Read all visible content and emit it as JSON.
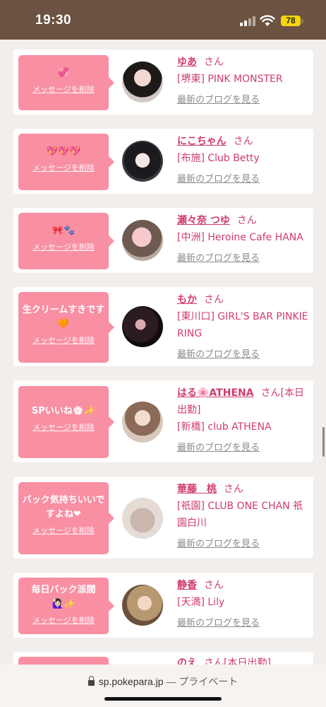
{
  "status": {
    "time": "19:30",
    "battery": "78"
  },
  "cards": [
    {
      "message": "💞",
      "delete": "メッセージを削除",
      "name": "ゆあ",
      "san": "さん",
      "shop": "[堺東] PINK MONSTER",
      "blog": "最新のブログを見る"
    },
    {
      "message": "💖💖💖",
      "delete": "メッセージを削除",
      "name": "にこちゃん",
      "san": "さん",
      "shop": "[布施] Club Betty",
      "blog": "最新のブログを見る"
    },
    {
      "message": "🎀🐾",
      "delete": "メッセージを削除",
      "name": "瀬々奈 つゆ",
      "san": "さん",
      "shop": "[中洲] Heroine Cafe HANA",
      "blog": "最新のブログを見る"
    },
    {
      "message": "生クリームすきです🧡",
      "delete": "メッセージを削除",
      "name": "もか",
      "san": "さん",
      "shop": "[東川口] GIRL'S BAR PINKIE RING",
      "blog": "最新のブログを見る"
    },
    {
      "message": "SPいいね💮✨",
      "delete": "メッセージを削除",
      "name": "はる🌸ATHENA",
      "san": "さん[本日出勤]",
      "shop": "[新橋] club ATHENA",
      "blog": "最新のブログを見る"
    },
    {
      "message": "バック気持ちいいですよね❤",
      "delete": "メッセージを削除",
      "name": "華藤　桃",
      "san": "さん",
      "shop": "[祇園] CLUB ONE CHAN 祇園白川",
      "blog": "最新のブログを見る"
    },
    {
      "message": "毎日バック派閥🙋🏻‍♀️✨",
      "delete": "メッセージを削除",
      "name": "静香",
      "san": "さん",
      "shop": "[天満] Lily",
      "blog": "最新のブログを見る"
    },
    {
      "message": "",
      "delete": "",
      "name": "のえ",
      "san": "さん[本日出勤]",
      "shop": "",
      "blog": ""
    }
  ],
  "url_bar": {
    "domain": "sp.pokepara.jp",
    "suffix": "— プライベート"
  }
}
